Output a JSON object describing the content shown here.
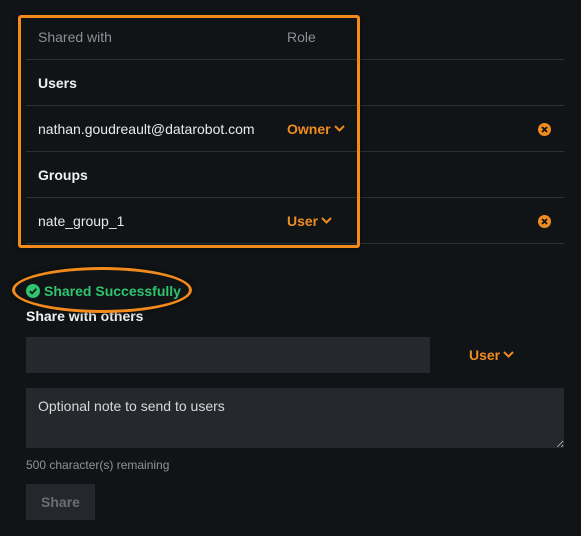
{
  "shared_table": {
    "header": {
      "shared_with": "Shared with",
      "role": "Role"
    },
    "users_section": "Users",
    "groups_section": "Groups",
    "users": [
      {
        "name": "nathan.goudreault@datarobot.com",
        "role": "Owner"
      }
    ],
    "groups": [
      {
        "name": "nate_group_1",
        "role": "User"
      }
    ]
  },
  "status": {
    "text": "Shared Successfully"
  },
  "share_form": {
    "title": "Share with others",
    "input_value": "",
    "role": "User",
    "note_placeholder": "Optional note to send to users",
    "remaining": "500 character(s) remaining",
    "share_label": "Share"
  },
  "colors": {
    "accent": "#f08c1f",
    "success": "#2fc46f",
    "background": "#111416",
    "field": "#25292d"
  },
  "icons": {
    "remove": "remove-circle-icon",
    "chevron": "chevron-down-icon",
    "success": "check-circle-icon"
  }
}
